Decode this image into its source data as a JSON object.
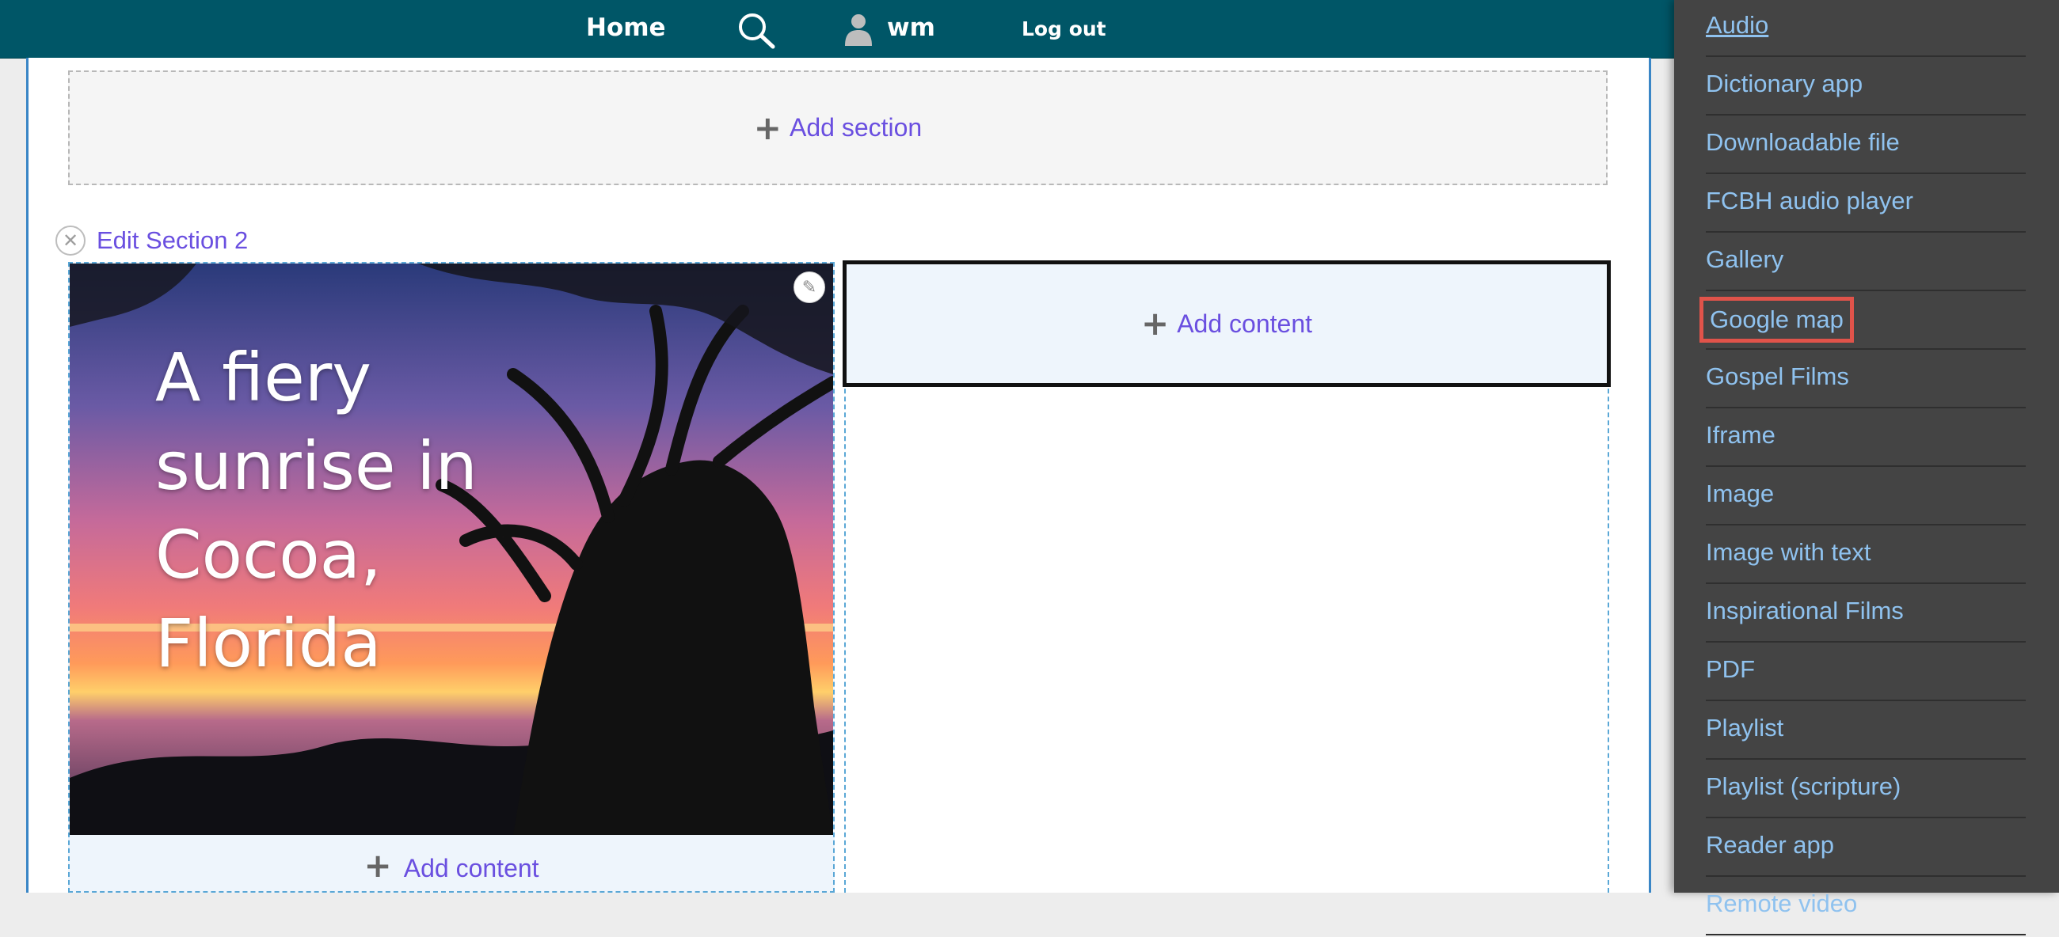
{
  "toolbar": {
    "home_label": "Home",
    "user_name": "wm",
    "logout_label": "Log out",
    "icons": [
      "search-icon",
      "user-icon"
    ]
  },
  "page": {
    "add_section_label": "Add section",
    "edit_section_label": "Edit Section 2",
    "hero_title": "A fiery sunrise in Cocoa, Florida",
    "add_content_label_1": "Add content",
    "add_content_label_2": "Add content"
  },
  "sidebar": {
    "items": [
      {
        "label": "Audio"
      },
      {
        "label": "Dictionary app"
      },
      {
        "label": "Downloadable file"
      },
      {
        "label": "FCBH audio player"
      },
      {
        "label": "Gallery"
      },
      {
        "label": "Google map",
        "highlighted": true
      },
      {
        "label": "Gospel Films"
      },
      {
        "label": "Iframe"
      },
      {
        "label": "Image"
      },
      {
        "label": "Image with text"
      },
      {
        "label": "Inspirational Films"
      },
      {
        "label": "PDF"
      },
      {
        "label": "Playlist"
      },
      {
        "label": "Playlist (scripture)"
      },
      {
        "label": "Reader app"
      },
      {
        "label": "Remote video"
      }
    ]
  },
  "colors": {
    "toolbar_bg": "#005667",
    "link": "#6a4fe0",
    "sidebar_bg": "#444444",
    "sidebar_link": "#8fc2ef",
    "highlight": "#e0534a"
  }
}
